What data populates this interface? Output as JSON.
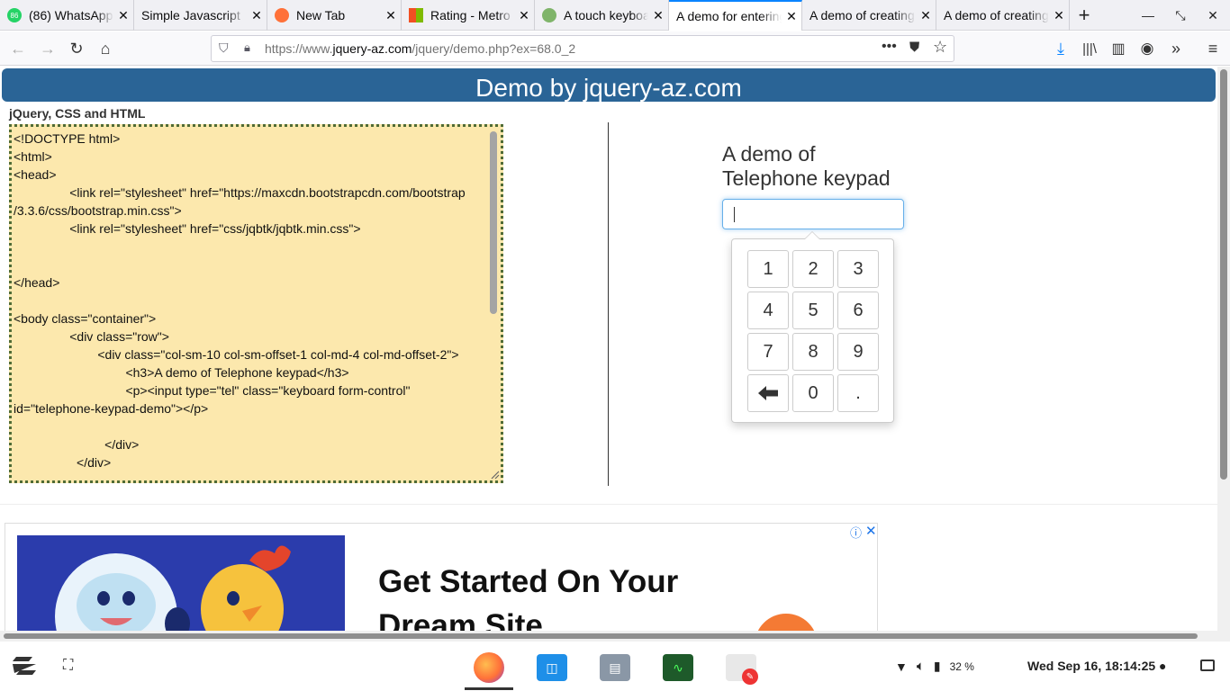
{
  "browser": {
    "tabs": [
      {
        "title": "(86) WhatsApp",
        "badge": "86",
        "favicon_color": "#25d366",
        "active": false
      },
      {
        "title": "Simple Javascript",
        "favicon_color": "",
        "active": false
      },
      {
        "title": "New Tab",
        "favicon_color": "#ff7139",
        "active": false
      },
      {
        "title": "Rating - Metro",
        "favicon_color": "#f25022",
        "active": false
      },
      {
        "title": "A touch keyboard",
        "favicon_color": "#7fb46a",
        "active": false
      },
      {
        "title": "A demo for entering",
        "favicon_color": "",
        "active": true
      },
      {
        "title": "A demo of creating",
        "favicon_color": "",
        "active": false
      },
      {
        "title": "A demo of creating",
        "favicon_color": "",
        "active": false
      }
    ],
    "new_tab_icon": "plus-icon",
    "url_prefix": "https://www.",
    "url_domain": "jquery-az.com",
    "url_path": "/jquery/demo.php?ex=68.0_2",
    "accent_color": "#0a84ff"
  },
  "page": {
    "banner": "Demo by jquery-az.com",
    "banner_color": "#2a6496",
    "code_label": "jQuery, CSS and HTML",
    "code_lines": "<!DOCTYPE html>\n<html>\n<head>\n\t\t<link rel=\"stylesheet\" href=\"https://maxcdn.bootstrapcdn.com/bootstrap\n/3.3.6/css/bootstrap.min.css\">\n\t\t<link rel=\"stylesheet\" href=\"css/jqbtk/jqbtk.min.css\">\n\n\n</head>\n\n<body class=\"container\">\n\t\t<div class=\"row\">\n\t\t\t<div class=\"col-sm-10 col-sm-offset-1 col-md-4 col-md-offset-2\">\n\t\t\t\t<h3>A demo of Telephone keypad</h3>\n\t\t\t\t<p><input type=\"tel\" class=\"keyboard form-control\"\nid=\"telephone-keypad-demo\"></p>\n\n\t\t\t  </div>\n\t\t  </div>",
    "code_bg_color": "#fce8ad",
    "demo_title_line1": "A demo of",
    "demo_title_line2": "Telephone keypad",
    "tel_input_value": "",
    "keypad_keys": [
      "1",
      "2",
      "3",
      "4",
      "5",
      "6",
      "7",
      "8",
      "9",
      "backspace",
      "0",
      "."
    ],
    "backspace_icon": "arrow-left-icon"
  },
  "ad": {
    "headline_line1": "Get Started On Your",
    "headline_line2": "Dream Site",
    "info_icon": "info-icon",
    "close_icon": "close-icon"
  },
  "taskbar": {
    "apps": [
      {
        "name": "firefox",
        "active": true
      },
      {
        "name": "software-center"
      },
      {
        "name": "files"
      },
      {
        "name": "system-monitor"
      },
      {
        "name": "text-editor"
      }
    ],
    "battery": "32 %",
    "clock": "Wed Sep 16, 18:14:25 ●"
  }
}
